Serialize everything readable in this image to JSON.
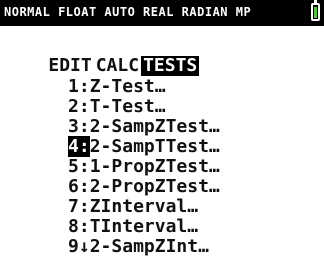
{
  "status_bar": {
    "text": "NORMAL FLOAT AUTO REAL RADIAN MP",
    "battery_icon": "battery-icon",
    "battery_color": "#54c43c"
  },
  "tabs": [
    {
      "label": "EDIT",
      "active": false
    },
    {
      "label": "CALC",
      "active": false
    },
    {
      "label": "TESTS",
      "active": true
    }
  ],
  "menu_items": [
    {
      "num": "1:",
      "label": "Z-Test…"
    },
    {
      "num": "2:",
      "label": "T-Test…"
    },
    {
      "num": "3:",
      "label": "2-SampZTest…"
    },
    {
      "num": "4:",
      "label": "2-SampTTest…",
      "selected": true
    },
    {
      "num": "5:",
      "label": "1-PropZTest…"
    },
    {
      "num": "6:",
      "label": "2-PropZTest…"
    },
    {
      "num": "7:",
      "label": "ZInterval…"
    },
    {
      "num": "8:",
      "label": "TInterval…"
    },
    {
      "num": "9↓",
      "label": "2-SampZInt…"
    }
  ]
}
